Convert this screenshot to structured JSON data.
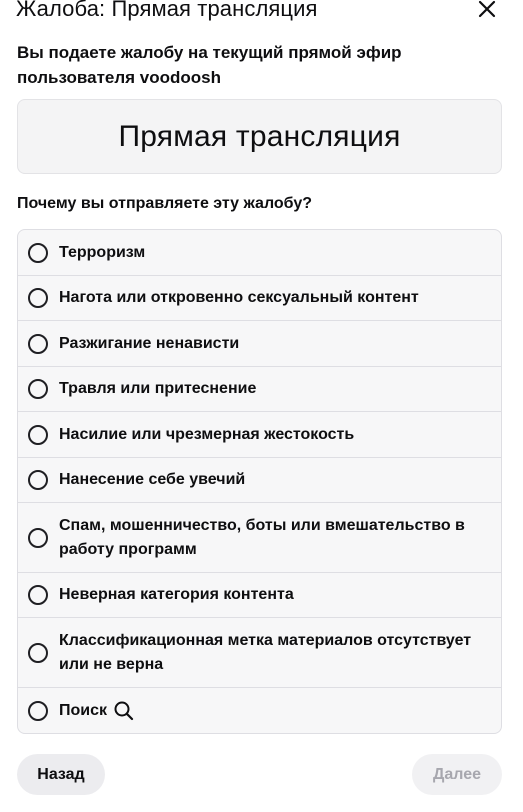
{
  "dialog": {
    "title": "Жалоба: Прямая трансляция",
    "intro": "Вы подаете жалобу на текущий прямой эфир пользователя voodoosh",
    "preview_label": "Прямая трансляция",
    "question": "Почему вы отправляете эту жалобу?"
  },
  "reasons": [
    {
      "label": "Терроризм"
    },
    {
      "label": "Нагота или откровенно сексуальный контент"
    },
    {
      "label": "Разжигание ненависти"
    },
    {
      "label": "Травля или притеснение"
    },
    {
      "label": "Насилие или чрезмерная жестокость"
    },
    {
      "label": "Нанесение себе увечий"
    },
    {
      "label": "Спам, мошенничество, боты или вмешательство в работу программ"
    },
    {
      "label": "Неверная категория контента"
    },
    {
      "label": "Классификационная метка материалов отсутствует или не верна"
    },
    {
      "label": "Поиск",
      "icon": "search-icon"
    }
  ],
  "footer": {
    "back_label": "Назад",
    "next_label": "Далее"
  },
  "icons": {
    "close": "close-icon",
    "radio": "radio-unchecked-icon"
  },
  "colors": {
    "text": "#0e0e10",
    "card_bg": "#f4f4f5",
    "list_bg": "#f7f7f8",
    "border": "#dedee3",
    "disabled_text": "#a7a7ae"
  }
}
